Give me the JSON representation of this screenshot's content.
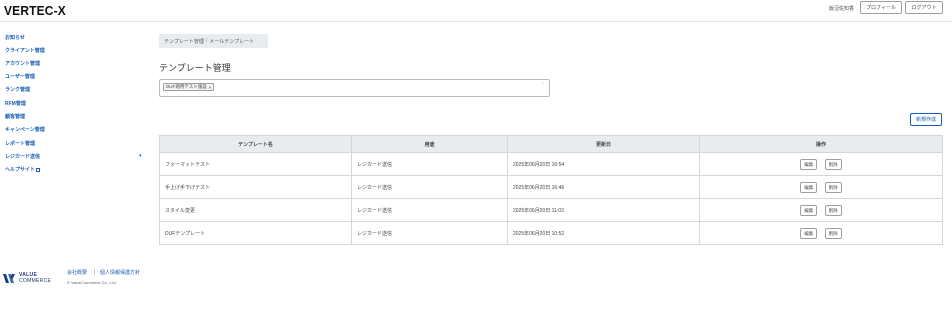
{
  "header": {
    "logo": "VERTEC-X",
    "user_name": "飯沼佐知香",
    "profile_label": "プロフィール",
    "logout_label": "ログアウト"
  },
  "sidebar": {
    "items": [
      {
        "label": "お知らせ"
      },
      {
        "label": "クライアント管理"
      },
      {
        "label": "アカウント管理"
      },
      {
        "label": "ユーザー管理"
      },
      {
        "label": "ランク管理"
      },
      {
        "label": "RFM管理"
      },
      {
        "label": "顧客管理"
      },
      {
        "label": "キャンペーン管理"
      },
      {
        "label": "レポート管理"
      },
      {
        "label": "レジカード送信"
      },
      {
        "label": "ヘルプサイト"
      }
    ],
    "expand_icon": "▾"
  },
  "breadcrumb": {
    "parent": "テンプレート管理",
    "separator": "/",
    "current": "メールテンプレート"
  },
  "page_title": "テンプレート管理",
  "filter": {
    "chip_label": "DUF適用テスト施設",
    "chip_close": "×",
    "dropdown_caret": "ˇ"
  },
  "new_button_label": "新規作成",
  "table": {
    "columns": [
      "テンプレート名",
      "用途",
      "更新日",
      "操作"
    ],
    "rows": [
      {
        "name": "フォーマットテスト",
        "usage": "レジカード送信",
        "updated": "2025年06月20日 16:54"
      },
      {
        "name": "手上げ手下げテスト",
        "usage": "レジカード送信",
        "updated": "2025年06月20日 16:46"
      },
      {
        "name": "スタイル変更",
        "usage": "レジカード送信",
        "updated": "2025年06月20日 11:03"
      },
      {
        "name": "DUFテンプレート",
        "usage": "レジカード送信",
        "updated": "2025年06月20日 10:52"
      }
    ],
    "edit_label": "編集",
    "delete_label": "削除"
  },
  "footer": {
    "brand_line1": "VALUE",
    "brand_line2": "COMMERCE",
    "link_company": "会社概要",
    "link_privacy": "個人情報保護方針",
    "copyright": "© ValueCommerce Co., Ltd."
  },
  "colors": {
    "link": "#1a5fb4",
    "brand_navy": "#1f3d7a",
    "table_header_bg": "#e9ecef"
  }
}
